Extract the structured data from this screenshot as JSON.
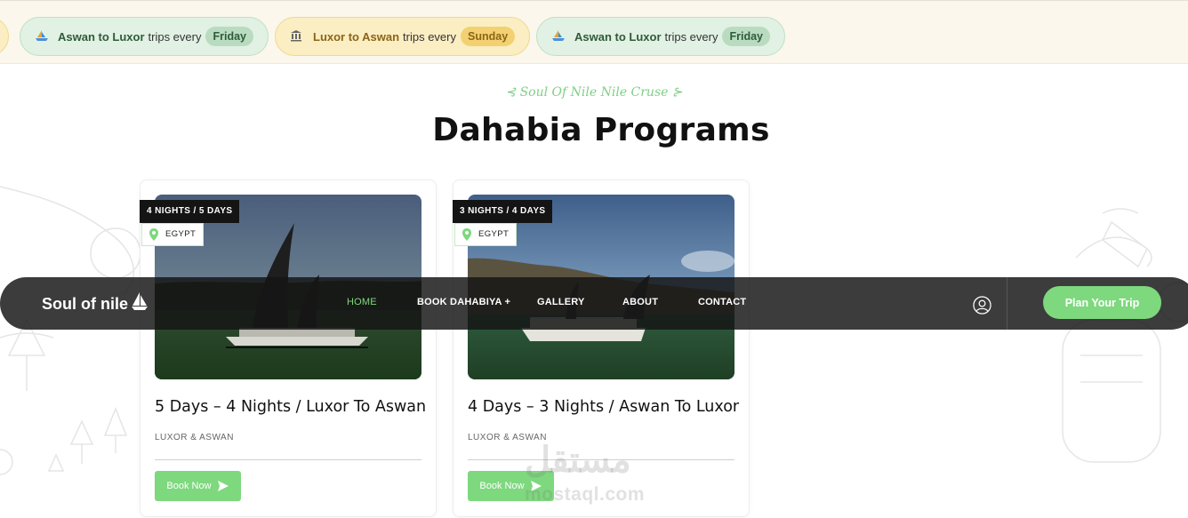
{
  "schedule_strip": [
    {
      "route": "Aswan to Luxor",
      "text": "trips every",
      "day": "Friday",
      "style": "green",
      "icon": "boat-icon"
    },
    {
      "route": "Luxor to Aswan",
      "text": "trips every",
      "day": "Sunday",
      "style": "yellow",
      "icon": "temple-icon"
    },
    {
      "route": "Aswan to Luxor",
      "text": "trips every",
      "day": "Friday",
      "style": "green",
      "icon": "boat-icon"
    }
  ],
  "section": {
    "eyebrow": "⊰ Soul Of Nile Nile Cruse ⊱",
    "title": "Dahabia Programs"
  },
  "cards": [
    {
      "duration_badge": "4 NIGHTS / 5 DAYS",
      "location": "EGYPT",
      "title": "5 Days – 4 Nights / Luxor To Aswan",
      "subtitle": "LUXOR & ASWAN",
      "button": "Book Now"
    },
    {
      "duration_badge": "3 NIGHTS / 4 DAYS",
      "location": "EGYPT",
      "title": "4 Days – 3 Nights / Aswan To Luxor",
      "subtitle": "LUXOR & ASWAN",
      "button": "Book Now"
    }
  ],
  "nav": {
    "logo": "Soul of nile",
    "links": [
      "HOME",
      "BOOK DAHABIYA +",
      "GALLERY",
      "ABOUT",
      "CONTACT"
    ],
    "active_link": "HOME",
    "cta": "Plan Your Trip"
  },
  "watermark": {
    "arabic": "مستقل",
    "latin": "mostaql.com"
  },
  "colors": {
    "accent": "#7ed87e",
    "nav_bg": "#141414",
    "strip_bg": "#fbf7ec"
  }
}
